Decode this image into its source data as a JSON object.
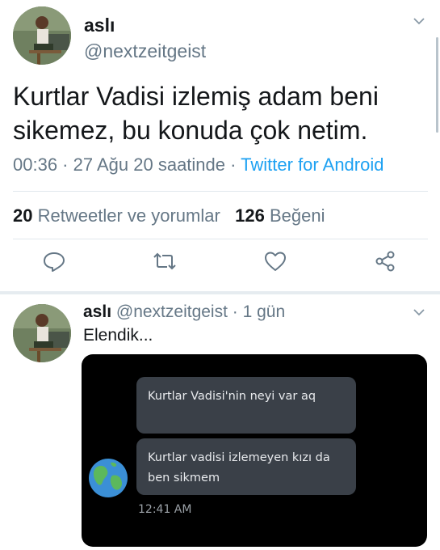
{
  "main_tweet": {
    "author_name": "aslı",
    "author_handle": "@nextzeitgeist",
    "text": "Kurtlar Vadisi izlemiş adam beni sikemez, bu konuda çok netim.",
    "time": "00:36",
    "date": "27 Ağu 20 saatinde",
    "source": "Twitter for Android",
    "stats": {
      "retweets_count": "20",
      "retweets_label": "Retweetler ve yorumlar",
      "likes_count": "126",
      "likes_label": "Beğeni"
    },
    "actions": {
      "reply": "reply-icon",
      "retweet": "retweet-icon",
      "like": "heart-icon",
      "share": "share-icon"
    }
  },
  "reply_tweet": {
    "author_name": "aslı",
    "author_handle": "@nextzeitgeist",
    "age": "1 gün",
    "text": "Elendik...",
    "media": {
      "message_1": "Kurtlar Vadisi'nin neyi var aq",
      "message_2": "Kurtlar vadisi izlemeyen kızı da ben sikmem",
      "timestamp": "12:41 AM"
    }
  },
  "colors": {
    "accent": "#1da1f2",
    "secondary_text": "#657786",
    "divider": "#e1e8ed",
    "bubble": "#3a4048"
  }
}
